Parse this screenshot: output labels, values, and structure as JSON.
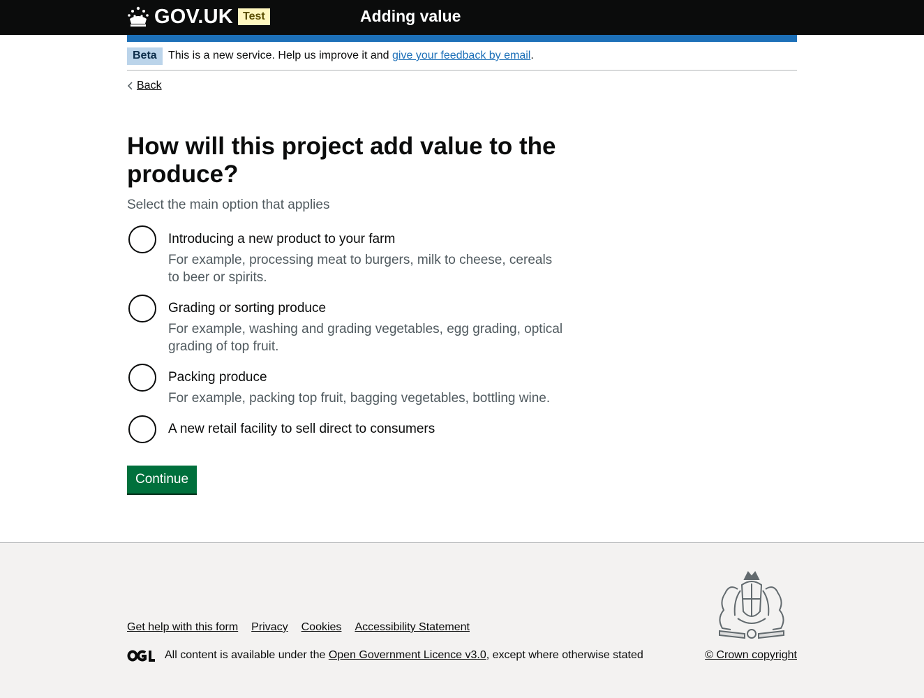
{
  "header": {
    "logo_text": "GOV.UK",
    "env_tag": "Test",
    "service_name": "Adding value"
  },
  "phase_banner": {
    "tag": "Beta",
    "text_before": "This is a new service. Help us improve it and ",
    "link_text": "give your feedback by email",
    "text_after": "."
  },
  "back_link": "Back",
  "question": {
    "heading": "How will this project add value to the produce?",
    "hint": "Select the main option that applies",
    "options": [
      {
        "label": "Introducing a new product to your farm",
        "hint": "For example, processing meat to burgers, milk to cheese, cereals to beer or spirits."
      },
      {
        "label": "Grading or sorting produce",
        "hint": "For example, washing and grading vegetables, egg grading, optical grading of top fruit."
      },
      {
        "label": "Packing produce",
        "hint": "For example, packing top fruit, bagging vegetables, bottling wine."
      },
      {
        "label": "A new retail facility to sell direct to consumers",
        "hint": ""
      }
    ]
  },
  "continue_label": "Continue",
  "footer": {
    "links": [
      "Get help with this form",
      "Privacy",
      "Cookies",
      "Accessibility Statement"
    ],
    "licence_before": "All content is available under the ",
    "licence_link": "Open Government Licence v3.0",
    "licence_after": ", except where otherwise stated",
    "copyright": "© Crown copyright"
  },
  "colors": {
    "header_bg": "#0b0c0c",
    "brand_blue": "#1d70b8",
    "button_green": "#00703c",
    "hint_grey": "#505a5f",
    "footer_bg": "#f3f2f1"
  },
  "icons": [
    "crown-icon",
    "chevron-left-icon",
    "ogl-logo",
    "royal-crest"
  ]
}
